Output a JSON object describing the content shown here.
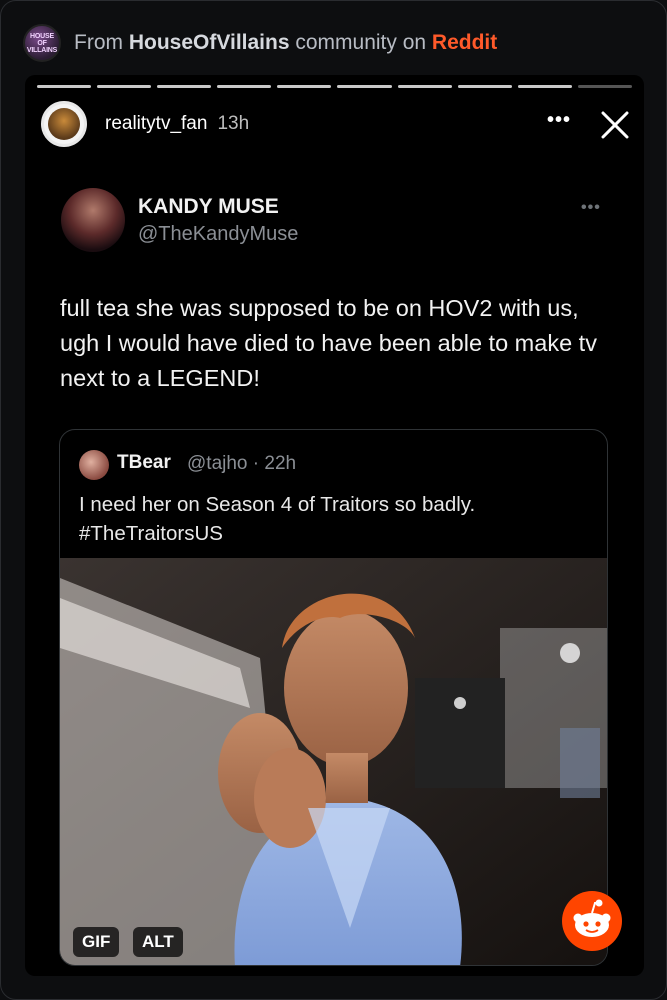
{
  "header": {
    "community_logo_text": "HOUSE OF VILLAINS",
    "from_label": "From",
    "community_name": "HouseOfVillains",
    "community_word": "community on",
    "platform": "Reddit"
  },
  "story": {
    "progress": {
      "segments": 10,
      "active_index": 8
    },
    "poster_name": "realitytv_fan",
    "poster_time": "13h",
    "more_label": "•••"
  },
  "tweet": {
    "display_name": "KANDY MUSE",
    "handle": "@TheKandyMuse",
    "more_label": "•••",
    "text": "full tea she was supposed to be on HOV2 with us, ugh I would have died to have been able to make tv next to a LEGEND!",
    "quote": {
      "display_name": "TBear",
      "meta": "@tajho · 22h",
      "text_line1": "I need her on Season 4 of Traitors so badly.",
      "text_line2": "#TheTraitorsUS",
      "badges": {
        "gif": "GIF",
        "alt": "ALT"
      }
    }
  },
  "colors": {
    "reddit_orange": "#ff4500",
    "background": "#0d0e10"
  }
}
